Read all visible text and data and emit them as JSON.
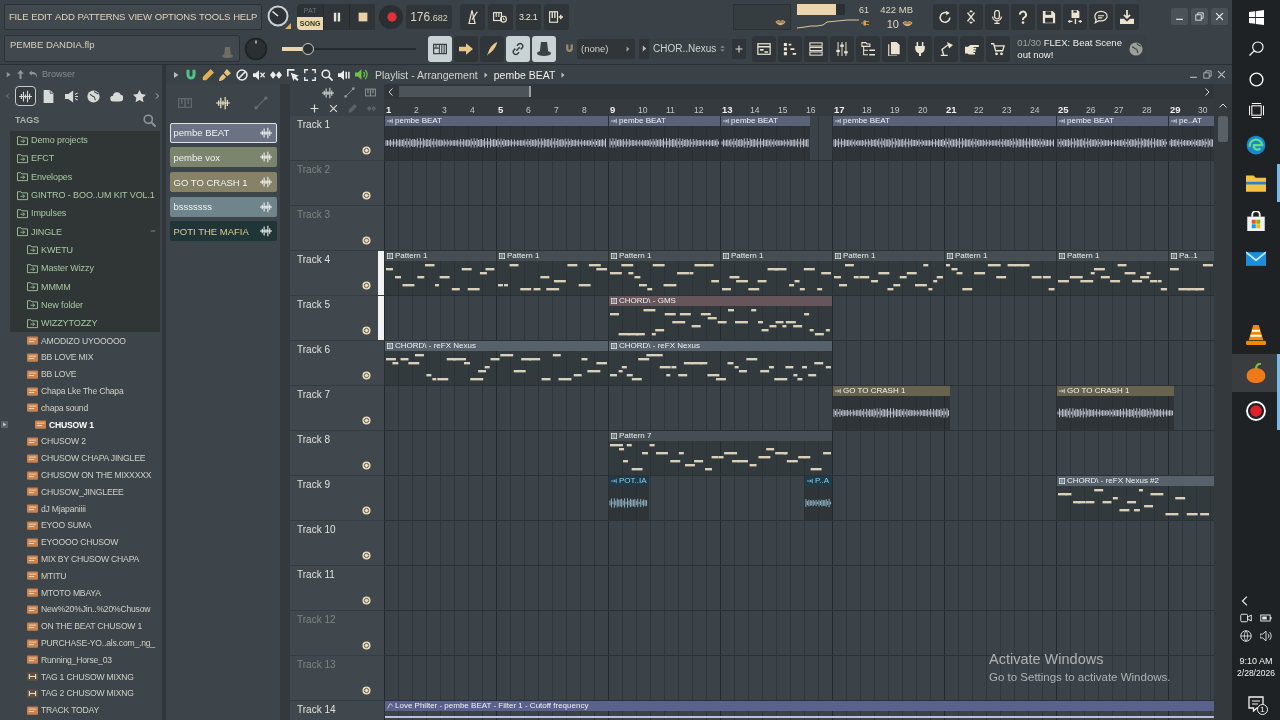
{
  "menu": [
    "FILE",
    "EDIT",
    "ADD",
    "PATTERNS",
    "VIEW",
    "OPTIONS",
    "TOOLS",
    "HELP"
  ],
  "project": {
    "file_name": "PEMBE DANDIA.flp"
  },
  "transport": {
    "modes": [
      {
        "label": "PAT",
        "selected": false
      },
      {
        "label": "SONG",
        "selected": true
      }
    ],
    "tempo_whole": "176",
    "tempo_fraction": ".682",
    "countdown": "3.2.1"
  },
  "master_slider": {
    "level": 0.17
  },
  "cpu": {
    "level": 0.82,
    "reading": "61",
    "memory": "422 MB",
    "polyphony": "10"
  },
  "toggles": [
    {
      "kind": "typing-keyboard",
      "on": true
    },
    {
      "kind": "arrow",
      "on": false
    },
    {
      "kind": "pen",
      "on": false
    },
    {
      "kind": "link",
      "on": true
    },
    {
      "kind": "hat",
      "on": true
    }
  ],
  "dropdown": {
    "value": "(none)"
  },
  "pattern_select": {
    "value": "CHOR..Nexus"
  },
  "news": {
    "counter": "01/30",
    "headline": "FLEX: Beat Scene out now!"
  },
  "browser": {
    "title": "Browser",
    "tabs": [
      {
        "kind": "all",
        "selected": true
      },
      {
        "kind": "files",
        "selected": false
      },
      {
        "kind": "plugins",
        "selected": false
      },
      {
        "kind": "online",
        "selected": false
      },
      {
        "kind": "cloud",
        "selected": false
      },
      {
        "kind": "favorites",
        "selected": false
      }
    ],
    "tags_label": "TAGS",
    "tree": [
      {
        "label": "Demo projects",
        "kind": "folder",
        "expanded": false,
        "selected": false
      },
      {
        "label": "EFCT",
        "kind": "folder",
        "expanded": false,
        "selected": false
      },
      {
        "label": "Envelopes",
        "kind": "folder",
        "expanded": false,
        "selected": false
      },
      {
        "label": "GINTRO - BOO..UM KIT VOL.1",
        "kind": "folder",
        "expanded": false,
        "selected": false
      },
      {
        "label": "Impulses",
        "kind": "folder",
        "expanded": false,
        "selected": false
      },
      {
        "label": "JINGLE",
        "kind": "folder",
        "expanded": true,
        "selected": false,
        "children": [
          {
            "label": "KWETU",
            "kind": "folder",
            "expanded": false,
            "selected": false
          },
          {
            "label": "Master Wizzy",
            "kind": "folder",
            "expanded": false,
            "selected": false
          },
          {
            "label": "MMMM",
            "kind": "folder",
            "expanded": false,
            "selected": false
          },
          {
            "label": "New folder",
            "kind": "folder",
            "expanded": false,
            "selected": false
          },
          {
            "label": "WIZZYTOZZY",
            "kind": "folder",
            "expanded": false,
            "selected": false
          },
          {
            "label": "AMODIZO UYOOOOO",
            "kind": "audio",
            "selected": false
          },
          {
            "label": "BB LOVE MIX",
            "kind": "audio",
            "selected": false
          },
          {
            "label": "BB LOVE",
            "kind": "audio",
            "selected": false
          },
          {
            "label": "Chapa Lke The Chapa",
            "kind": "audio",
            "selected": false
          },
          {
            "label": "chapa sound",
            "kind": "audio",
            "selected": false
          },
          {
            "label": "CHUSOW 1",
            "kind": "audio",
            "selected": true
          },
          {
            "label": "CHUSOW 2",
            "kind": "audio",
            "selected": false
          },
          {
            "label": "CHUSOW CHAPA JINGLEE",
            "kind": "audio",
            "selected": false
          },
          {
            "label": "CHUSOW ON THE MIXXXXX",
            "kind": "audio",
            "selected": false
          },
          {
            "label": "CHUSOW_JINGLEEE",
            "kind": "audio",
            "selected": false
          },
          {
            "label": "dJ Mjapaniiii",
            "kind": "audio",
            "selected": false
          },
          {
            "label": "EYOO SUMA",
            "kind": "audio",
            "selected": false
          },
          {
            "label": "EYOOOO CHUSOW",
            "kind": "audio",
            "selected": false
          },
          {
            "label": "MIX BY CHUSOW CHAPA",
            "kind": "audio",
            "selected": false
          },
          {
            "label": "MTITU",
            "kind": "audio",
            "selected": false
          },
          {
            "label": "MTOTO MBAYA",
            "kind": "audio",
            "selected": false
          },
          {
            "label": "New%20%Jin..%20%Chusow",
            "kind": "audio",
            "selected": false
          },
          {
            "label": "ON THE BEAT CHUSOW 1",
            "kind": "audio",
            "selected": false
          },
          {
            "label": "PURCHASE-YO..als.com_.ng_",
            "kind": "audio",
            "selected": false
          },
          {
            "label": "Running_Horse_03",
            "kind": "audio",
            "selected": false
          },
          {
            "label": "TAG 1 CHUSOW MIXNG",
            "kind": "pattern",
            "selected": false
          },
          {
            "label": "TAG 2 CHUSOW MIXNG",
            "kind": "pattern",
            "selected": false
          },
          {
            "label": "TRACK TODAY",
            "kind": "audio",
            "selected": false
          }
        ]
      }
    ]
  },
  "picker": {
    "tabs": [
      {
        "kind": "patterns",
        "selected": false
      },
      {
        "kind": "audio",
        "selected": true
      },
      {
        "kind": "automation",
        "selected": false
      }
    ],
    "clips": [
      {
        "label": "pembe BEAT",
        "color": "#6b7284",
        "selected": true
      },
      {
        "label": "pembe vox",
        "color": "#7b846c",
        "selected": false
      },
      {
        "label": "GO TO CRASH 1",
        "color": "#858268",
        "selected": false
      },
      {
        "label": "bsssssss",
        "color": "#6f848b",
        "selected": false
      },
      {
        "label": "POTI THE MAFIA",
        "color": "#1f3537",
        "selected": false
      }
    ]
  },
  "playlist": {
    "title": "Playlist - Arrangement",
    "arrangement": "pembe BEAT",
    "bars": [
      "1",
      "2",
      "3",
      "4",
      "5",
      "6",
      "7",
      "8",
      "9",
      "10",
      "11",
      "12",
      "13",
      "14",
      "15",
      "16",
      "17",
      "18",
      "19",
      "20",
      "21",
      "22",
      "23",
      "24",
      "25",
      "26",
      "27",
      "28",
      "29",
      "30"
    ],
    "tracks": [
      {
        "name": "Track 1",
        "dimmed": false,
        "selected": false,
        "on": true,
        "clips": [
          {
            "label": "pembe BEAT",
            "kind": "audio",
            "color": "#5a6278"
          },
          {
            "label": "pembe BEAT",
            "kind": "audio",
            "color": "#5a6278"
          },
          {
            "label": "pembe BEAT",
            "kind": "audio",
            "color": "#5a6278"
          },
          {
            "label": "pembe BEAT",
            "kind": "audio",
            "color": "#5a6278"
          },
          {
            "label": "pembe BEAT",
            "kind": "audio",
            "color": "#5a6278"
          },
          {
            "label": "pe..AT",
            "kind": "audio",
            "color": "#5a6278"
          }
        ]
      },
      {
        "name": "Track 2",
        "dimmed": true,
        "selected": false,
        "on": true
      },
      {
        "name": "Track 3",
        "dimmed": true,
        "selected": false,
        "on": true
      },
      {
        "name": "Track 4",
        "dimmed": false,
        "selected": true,
        "on": true,
        "clips": [
          {
            "label": "Pattern 1",
            "kind": "pattern",
            "color": "#474e53"
          },
          {
            "label": "Pattern 1",
            "kind": "pattern",
            "color": "#474e53"
          },
          {
            "label": "Pattern 1",
            "kind": "pattern",
            "color": "#474e53"
          },
          {
            "label": "Pattern 1",
            "kind": "pattern",
            "color": "#474e53"
          },
          {
            "label": "Pattern 1",
            "kind": "pattern",
            "color": "#474e53"
          },
          {
            "label": "Pattern 1",
            "kind": "pattern",
            "color": "#474e53"
          },
          {
            "label": "Pattern 1",
            "kind": "pattern",
            "color": "#474e53"
          },
          {
            "label": "Pa..1",
            "kind": "pattern",
            "color": "#474e53"
          }
        ]
      },
      {
        "name": "Track 5",
        "dimmed": false,
        "selected": true,
        "on": true,
        "clips": [
          {
            "label": "CHORD\\ - GMS",
            "kind": "pattern",
            "color": "#66565c"
          }
        ]
      },
      {
        "name": "Track 6",
        "dimmed": false,
        "selected": false,
        "on": true,
        "clips": [
          {
            "label": "CHORD\\ - reFX Nexus",
            "kind": "pattern",
            "color": "#56616b"
          },
          {
            "label": "CHORD\\ - reFX Nexus",
            "kind": "pattern",
            "color": "#56616b"
          }
        ]
      },
      {
        "name": "Track 7",
        "dimmed": false,
        "selected": false,
        "on": true,
        "clips": [
          {
            "label": "GO TO CRASH 1",
            "kind": "audio",
            "color": "#66644f"
          },
          {
            "label": "GO TO CRASH 1",
            "kind": "audio",
            "color": "#66644f"
          }
        ]
      },
      {
        "name": "Track 8",
        "dimmed": false,
        "selected": false,
        "on": true,
        "clips": [
          {
            "label": "Pattern 7",
            "kind": "pattern",
            "color": "#474e53"
          }
        ]
      },
      {
        "name": "Track 9",
        "dimmed": false,
        "selected": false,
        "on": true,
        "clips": [
          {
            "label": "POT..IA",
            "kind": "audio",
            "color": "#1f3a48"
          },
          {
            "label": "P..A",
            "kind": "audio",
            "color": "#1f3a48"
          },
          {
            "label": "CHORD\\ - reFX Nexus #2",
            "kind": "pattern",
            "color": "#56616b"
          }
        ]
      },
      {
        "name": "Track 10",
        "dimmed": false,
        "selected": false,
        "on": true
      },
      {
        "name": "Track 11",
        "dimmed": false,
        "selected": false,
        "on": true
      },
      {
        "name": "Track 12",
        "dimmed": true,
        "selected": false,
        "on": true
      },
      {
        "name": "Track 13",
        "dimmed": true,
        "selected": false,
        "on": true
      },
      {
        "name": "Track 14",
        "dimmed": false,
        "selected": false,
        "clips": [
          {
            "label": "Love Philter - pembe BEAT - Filter 1 - Cutoff frequency",
            "kind": "automation",
            "color": "#5a618c"
          }
        ]
      }
    ]
  },
  "os_notice": {
    "title": "Activate Windows",
    "text": "Go to Settings to activate Windows."
  },
  "taskbar": {
    "apps": [
      {
        "kind": "edge",
        "running": false,
        "selected": false
      },
      {
        "kind": "explorer",
        "running": true,
        "selected": false
      },
      {
        "kind": "store",
        "running": false,
        "selected": false
      },
      {
        "kind": "mail",
        "running": false,
        "selected": false
      },
      {
        "kind": "vlc",
        "running": false,
        "selected": false
      },
      {
        "kind": "fl-studio",
        "running": true,
        "selected": true
      },
      {
        "kind": "recorder",
        "running": true,
        "selected": false
      }
    ],
    "time": "9:10 AM",
    "date": "2/28/2026",
    "notifications": "1"
  }
}
